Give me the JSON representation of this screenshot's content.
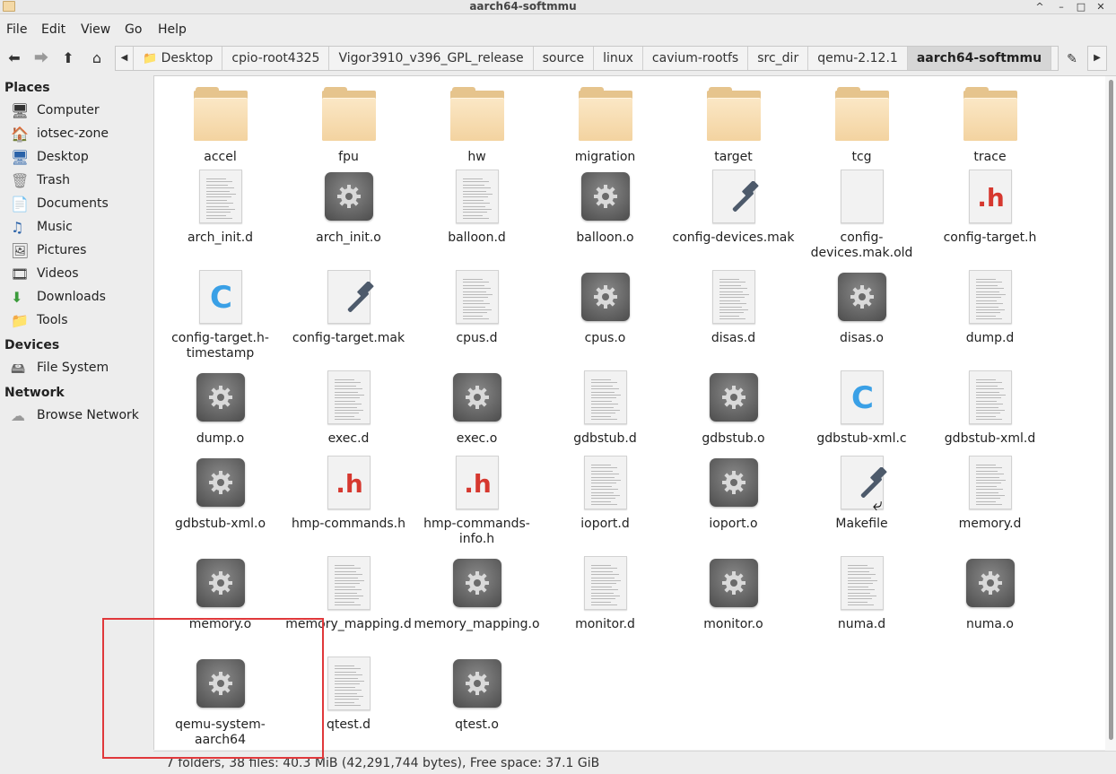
{
  "window": {
    "title": "aarch64-softmmu",
    "controls": [
      "^",
      "–",
      "□",
      "✕"
    ]
  },
  "menu": [
    "File",
    "Edit",
    "View",
    "Go",
    "Help"
  ],
  "breadcrumbs": [
    "Desktop",
    "cpio-root4325",
    "Vigor3910_v396_GPL_release",
    "source",
    "linux",
    "cavium-rootfs",
    "src_dir",
    "qemu-2.12.1",
    "aarch64-softmmu"
  ],
  "sidebar": {
    "places_header": "Places",
    "places": [
      {
        "label": "Computer",
        "icon": "computer-icon"
      },
      {
        "label": "iotsec-zone",
        "icon": "home-icon"
      },
      {
        "label": "Desktop",
        "icon": "desktop-icon"
      },
      {
        "label": "Trash",
        "icon": "trash-icon"
      },
      {
        "label": "Documents",
        "icon": "documents-icon"
      },
      {
        "label": "Music",
        "icon": "music-icon"
      },
      {
        "label": "Pictures",
        "icon": "pictures-icon"
      },
      {
        "label": "Videos",
        "icon": "videos-icon"
      },
      {
        "label": "Downloads",
        "icon": "downloads-icon"
      },
      {
        "label": "Tools",
        "icon": "folder-icon"
      }
    ],
    "devices_header": "Devices",
    "devices": [
      {
        "label": "File System",
        "icon": "drive-icon"
      }
    ],
    "network_header": "Network",
    "network": [
      {
        "label": "Browse Network",
        "icon": "network-icon"
      }
    ]
  },
  "files": [
    {
      "name": "accel",
      "type": "folder"
    },
    {
      "name": "fpu",
      "type": "folder"
    },
    {
      "name": "hw",
      "type": "folder"
    },
    {
      "name": "migration",
      "type": "folder"
    },
    {
      "name": "target",
      "type": "folder"
    },
    {
      "name": "tcg",
      "type": "folder"
    },
    {
      "name": "trace",
      "type": "folder"
    },
    {
      "name": "arch_init.d",
      "type": "text"
    },
    {
      "name": "arch_init.o",
      "type": "binary"
    },
    {
      "name": "balloon.d",
      "type": "text"
    },
    {
      "name": "balloon.o",
      "type": "binary"
    },
    {
      "name": "config-devices.mak",
      "type": "make"
    },
    {
      "name": "config-\ndevices.mak.old",
      "type": "blank"
    },
    {
      "name": "config-target.h",
      "type": "header"
    },
    {
      "name": "config-target.h-\ntimestamp",
      "type": "csource"
    },
    {
      "name": "config-target.mak",
      "type": "make"
    },
    {
      "name": "cpus.d",
      "type": "text"
    },
    {
      "name": "cpus.o",
      "type": "binary"
    },
    {
      "name": "disas.d",
      "type": "text"
    },
    {
      "name": "disas.o",
      "type": "binary"
    },
    {
      "name": "dump.d",
      "type": "text"
    },
    {
      "name": "dump.o",
      "type": "binary"
    },
    {
      "name": "exec.d",
      "type": "text"
    },
    {
      "name": "exec.o",
      "type": "binary"
    },
    {
      "name": "gdbstub.d",
      "type": "text"
    },
    {
      "name": "gdbstub.o",
      "type": "binary"
    },
    {
      "name": "gdbstub-xml.c",
      "type": "csource"
    },
    {
      "name": "gdbstub-xml.d",
      "type": "text"
    },
    {
      "name": "gdbstub-xml.o",
      "type": "binary"
    },
    {
      "name": "hmp-commands.h",
      "type": "header"
    },
    {
      "name": "hmp-commands-\ninfo.h",
      "type": "header"
    },
    {
      "name": "ioport.d",
      "type": "text"
    },
    {
      "name": "ioport.o",
      "type": "binary"
    },
    {
      "name": "Makefile",
      "type": "make-link"
    },
    {
      "name": "memory.d",
      "type": "text"
    },
    {
      "name": "memory.o",
      "type": "binary"
    },
    {
      "name": "memory_mapping.d",
      "type": "text"
    },
    {
      "name": "memory_mapping.o",
      "type": "binary"
    },
    {
      "name": "monitor.d",
      "type": "text"
    },
    {
      "name": "monitor.o",
      "type": "binary"
    },
    {
      "name": "numa.d",
      "type": "text"
    },
    {
      "name": "numa.o",
      "type": "binary"
    },
    {
      "name": "qemu-system-\naarch64",
      "type": "binary"
    },
    {
      "name": "qtest.d",
      "type": "text"
    },
    {
      "name": "qtest.o",
      "type": "binary"
    }
  ],
  "status": "7 folders, 38 files: 40.3 MiB (42,291,744 bytes), Free space: 37.1 GiB",
  "colors": {
    "highlight": "#e0383b",
    "folder": "#f3d3a0",
    "header_h": "#d6382f",
    "c_source": "#3aa0e6"
  }
}
